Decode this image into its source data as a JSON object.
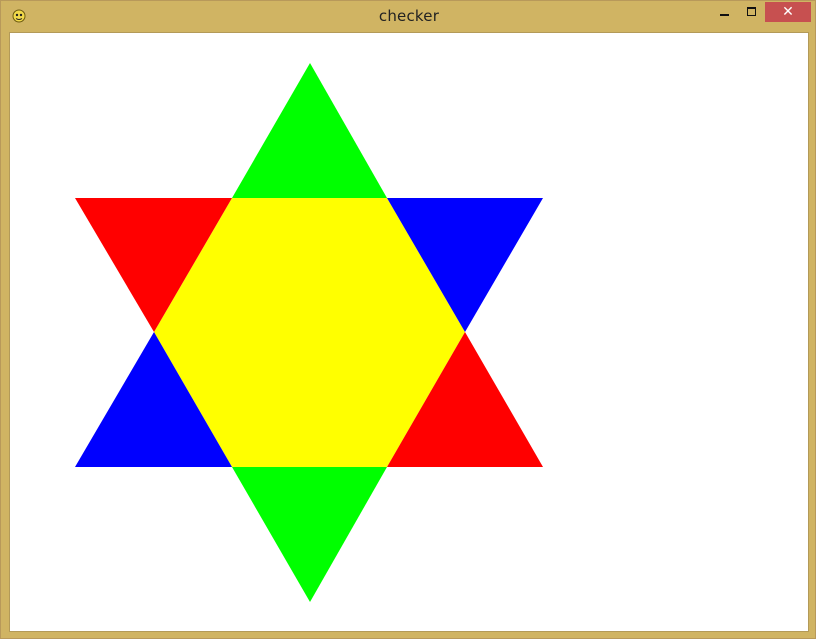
{
  "window": {
    "title": "checker",
    "icon": "pygame-snake-icon",
    "controls": {
      "minimize_icon": "minimize-icon",
      "maximize_icon": "maximize-icon",
      "close_glyph": "✕"
    },
    "colors": {
      "frame": "#d0b463",
      "close_button": "#c75050"
    }
  },
  "canvas": {
    "background": "#ffffff",
    "shape": "hexagram",
    "colors": {
      "center": "#ffff00",
      "top": "#00ff00",
      "bottom": "#00ff00",
      "upper_left": "#ff0000",
      "lower_right": "#ff0000",
      "upper_right": "#0000ff",
      "lower_left": "#0000ff"
    }
  }
}
